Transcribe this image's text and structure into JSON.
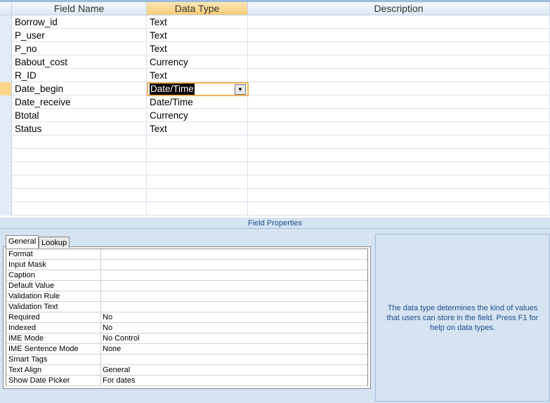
{
  "columns": {
    "field_name": "Field Name",
    "data_type": "Data Type",
    "description": "Description"
  },
  "rows": [
    {
      "name": "Borrow_id",
      "type": "Text"
    },
    {
      "name": "P_user",
      "type": "Text"
    },
    {
      "name": "P_no",
      "type": "Text"
    },
    {
      "name": "Babout_cost",
      "type": "Currency"
    },
    {
      "name": "R_ID",
      "type": "Text"
    },
    {
      "name": "Date_begin",
      "type": "Date/Time"
    },
    {
      "name": "Date_receive",
      "type": "Date/Time"
    },
    {
      "name": "Btotal",
      "type": "Currency"
    },
    {
      "name": "Status",
      "type": "Text"
    }
  ],
  "field_properties": "Field Properties",
  "tabs": {
    "general": "General",
    "lookup": "Lookup"
  },
  "properties": [
    {
      "label": "Format",
      "value": ""
    },
    {
      "label": "Input Mask",
      "value": ""
    },
    {
      "label": "Caption",
      "value": ""
    },
    {
      "label": "Default Value",
      "value": ""
    },
    {
      "label": "Validation Rule",
      "value": ""
    },
    {
      "label": "Validation Text",
      "value": ""
    },
    {
      "label": "Required",
      "value": "No"
    },
    {
      "label": "Indexed",
      "value": "No"
    },
    {
      "label": "IME Mode",
      "value": "No Control"
    },
    {
      "label": "IME Sentence Mode",
      "value": "None"
    },
    {
      "label": "Smart Tags",
      "value": ""
    },
    {
      "label": "Text Align",
      "value": "General"
    },
    {
      "label": "Show Date Picker",
      "value": "For dates"
    }
  ],
  "help_text": "The data type determines the kind of values that users can store in the field.  Press F1 for help on data types."
}
